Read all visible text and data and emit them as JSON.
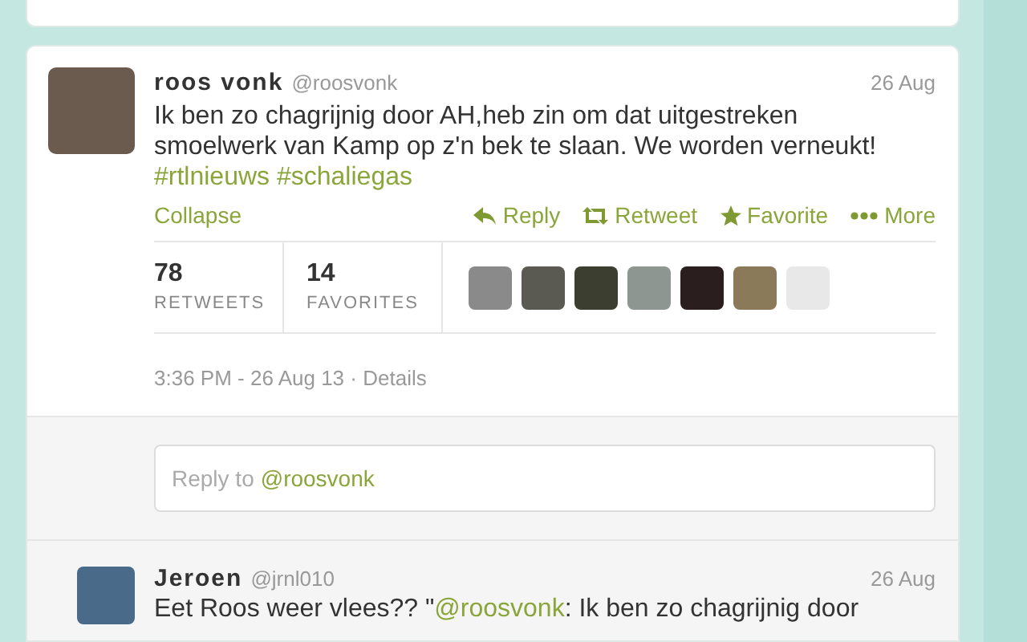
{
  "tweet": {
    "name": "roos vonk",
    "handle": "@roosvonk",
    "date": "26 Aug",
    "text": "Ik ben zo chagrijnig door AH,heb zin om dat uitgestreken smoelwerk van Kamp op z'n bek te slaan. We worden verneukt!",
    "hashtags": [
      "#rtlnieuws",
      "#schaliegas"
    ],
    "collapse": "Collapse",
    "actions": [
      {
        "kind": "reply",
        "label": "Reply"
      },
      {
        "kind": "retweet",
        "label": "Retweet"
      },
      {
        "kind": "favorite",
        "label": "Favorite"
      },
      {
        "kind": "more",
        "label": "More"
      }
    ],
    "stats": [
      {
        "value": "78",
        "label": "RETWEETS"
      },
      {
        "value": "14",
        "label": "FAVORITES"
      }
    ],
    "timestamp": "3:36 PM - 26 Aug 13",
    "separator": "·",
    "details": "Details"
  },
  "reply_box": {
    "placeholder": "Reply to",
    "mention": "@roosvonk"
  },
  "replies": [
    {
      "name": "Jeroen",
      "handle": "@jrnl010",
      "date": "26 Aug",
      "text_before": "Eet Roos weer vlees?? \"",
      "mention": "@roosvonk",
      "text_after": ": Ik ben zo chagrijnig door"
    }
  ]
}
